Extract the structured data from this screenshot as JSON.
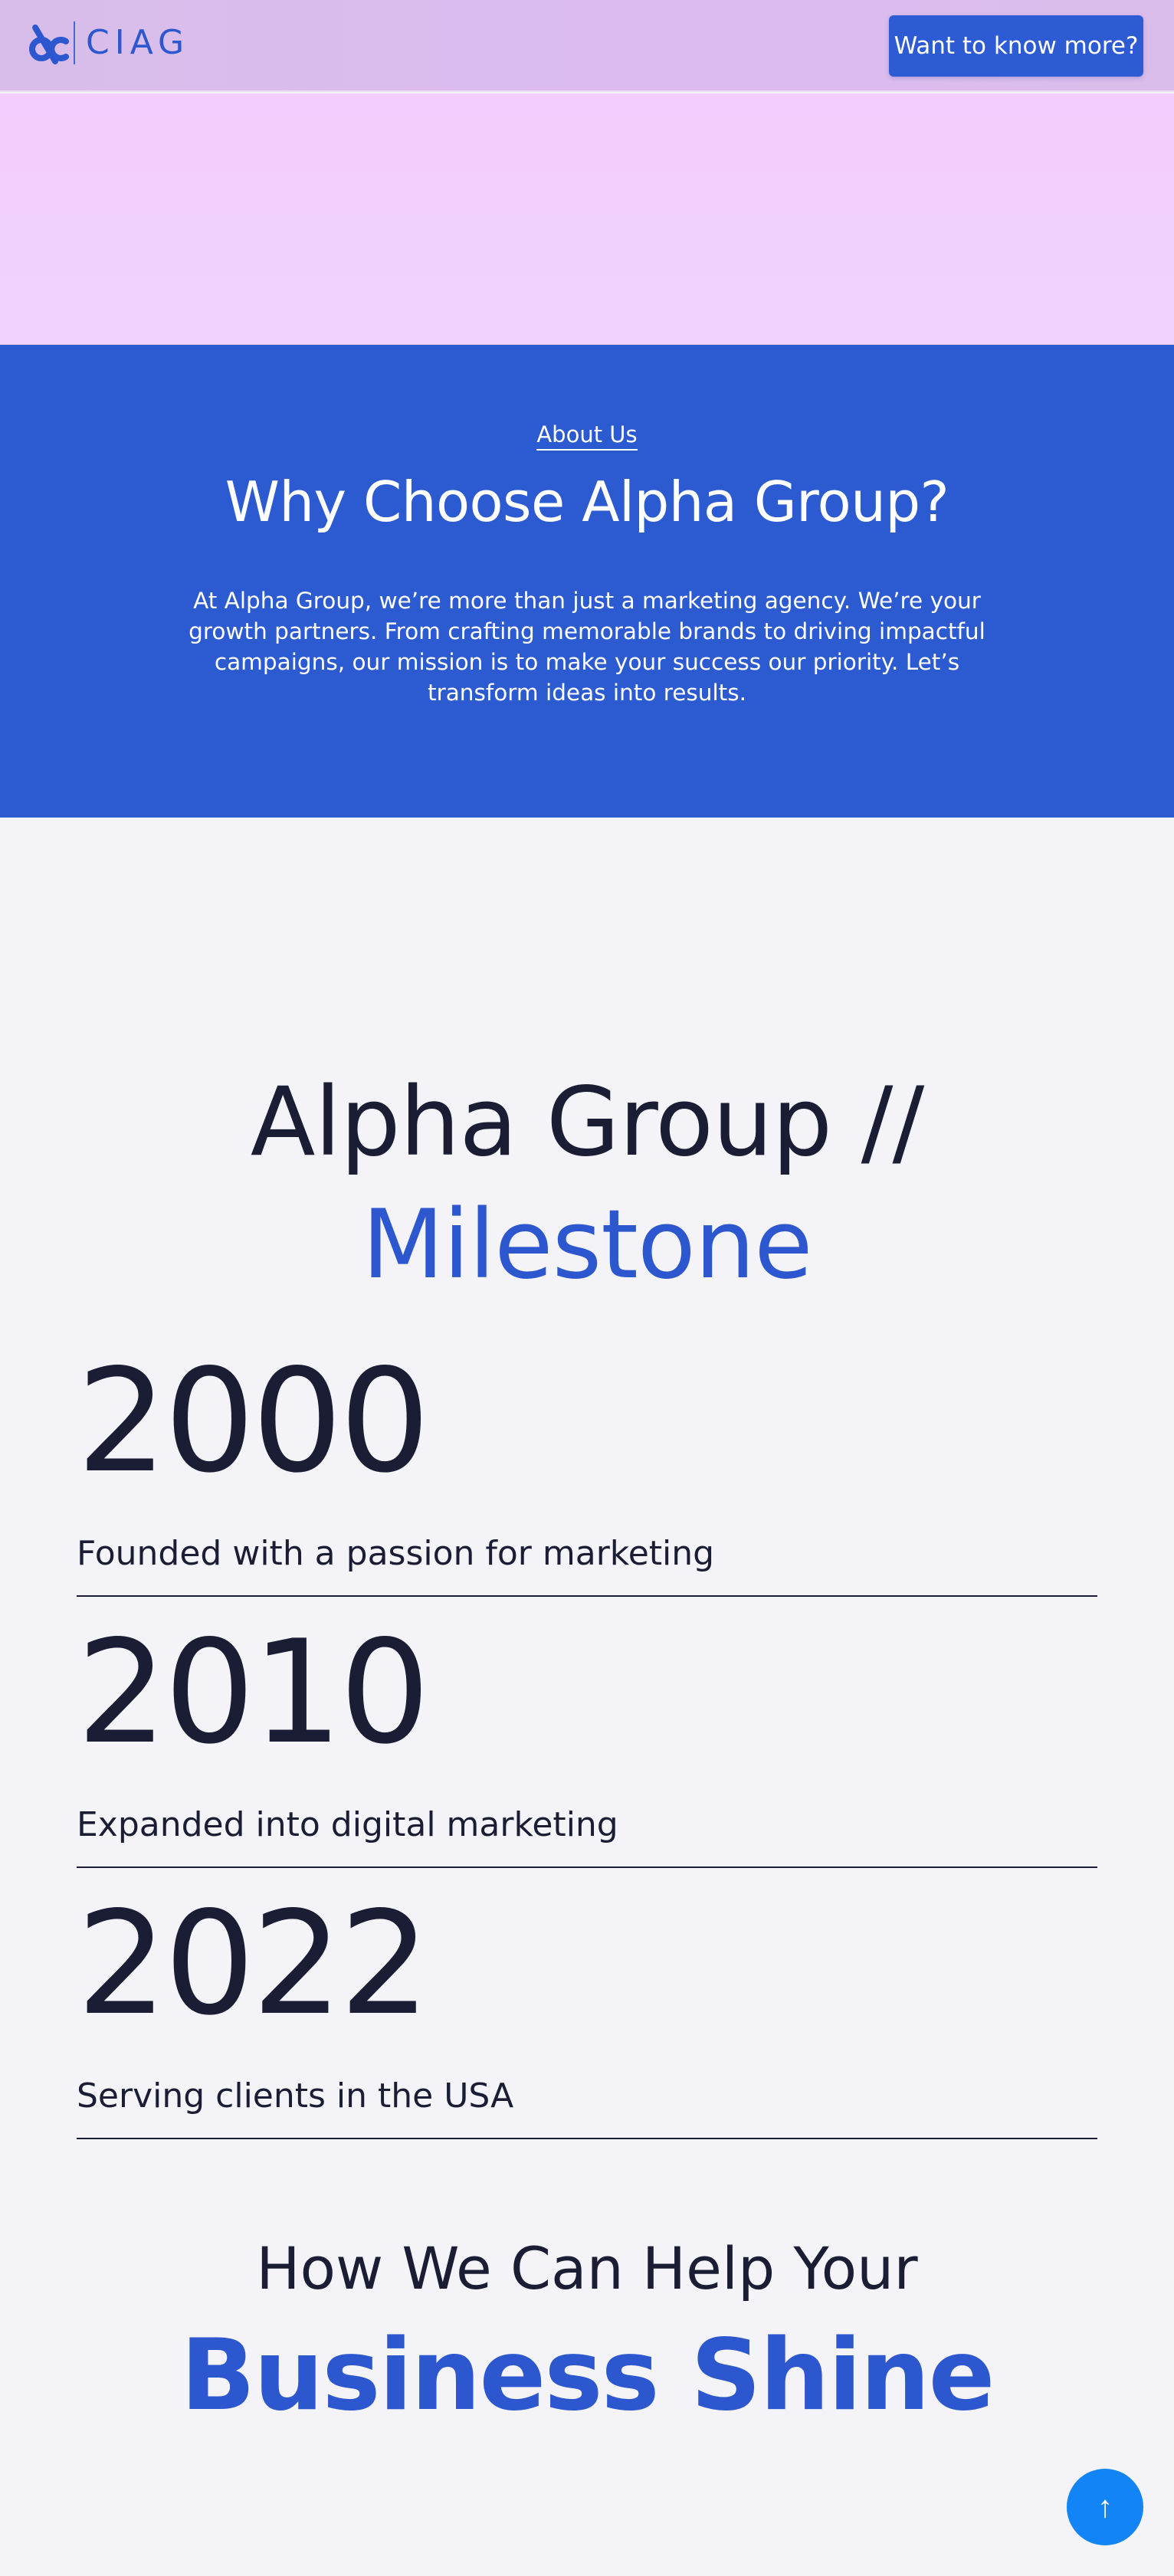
{
  "header": {
    "logo_text": "CIAG",
    "cta_label": "Want to know more?"
  },
  "about": {
    "eyebrow": "About Us",
    "title": "Why Choose Alpha Group?",
    "body": "At Alpha Group, we’re more than just a marketing agency. We’re your growth partners. From crafting memorable brands to driving impactful campaigns, our mission is to make your success our priority. Let’s transform ideas into results."
  },
  "milestones": {
    "title_line1": "Alpha Group //",
    "title_line2": "Milestone",
    "items": [
      {
        "year": "2000",
        "desc": "Founded with a passion for marketing"
      },
      {
        "year": "2010",
        "desc": "Expanded into digital marketing"
      },
      {
        "year": "2022",
        "desc": "Serving clients in the USA"
      }
    ]
  },
  "help": {
    "line1": "How We Can Help Your",
    "line2": "Business Shine"
  },
  "scroll_top": {
    "icon": "arrow-up-icon",
    "glyph": "↑"
  },
  "colors": {
    "brand_blue": "#2d57cf",
    "about_bg": "#2c5bd1",
    "header_bg": "#dcbcef",
    "hero_bg": "#f3cdfd",
    "page_bg": "#f3f3f8",
    "scroll_btn": "#1284f5",
    "text_dark": "#1a1d33"
  }
}
